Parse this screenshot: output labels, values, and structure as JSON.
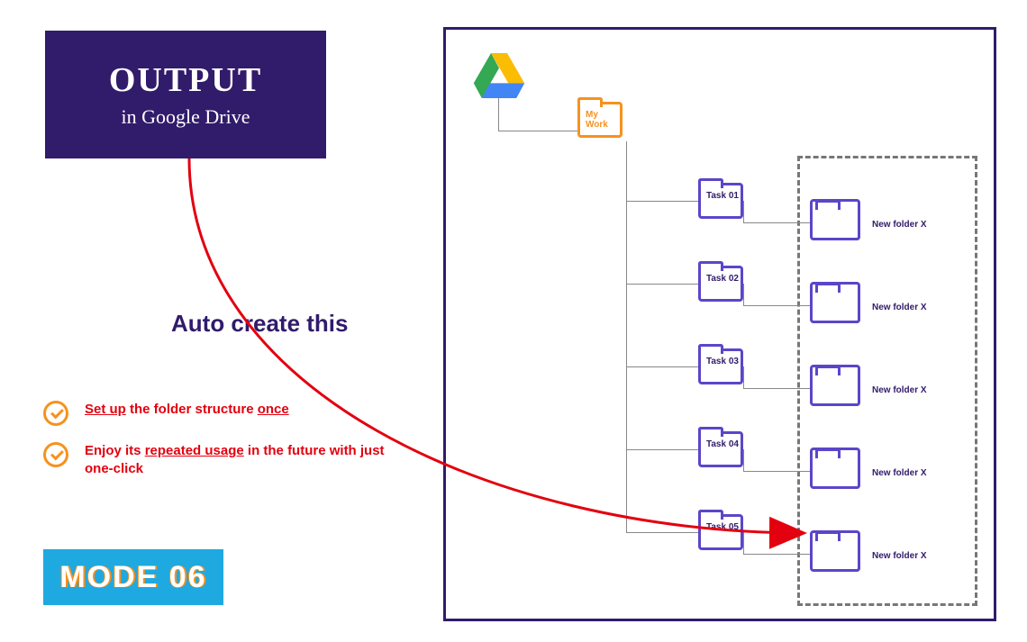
{
  "output_box": {
    "line1": "OUTPUT",
    "line2": "in Google Drive"
  },
  "auto_create": "Auto create this",
  "bullets": [
    {
      "html": "<u>Set up</u> the folder structure <u>once</u>"
    },
    {
      "html": "Enjoy its <u>repeated usage</u> in the future with just one-click"
    }
  ],
  "mode_badge": "MODE 06",
  "root_folder": "My Work",
  "tasks": [
    "Task 01",
    "Task 02",
    "Task 03",
    "Task 04",
    "Task 05"
  ],
  "new_folders": [
    "New folder X",
    "New folder X",
    "New folder X",
    "New folder X",
    "New folder X"
  ]
}
